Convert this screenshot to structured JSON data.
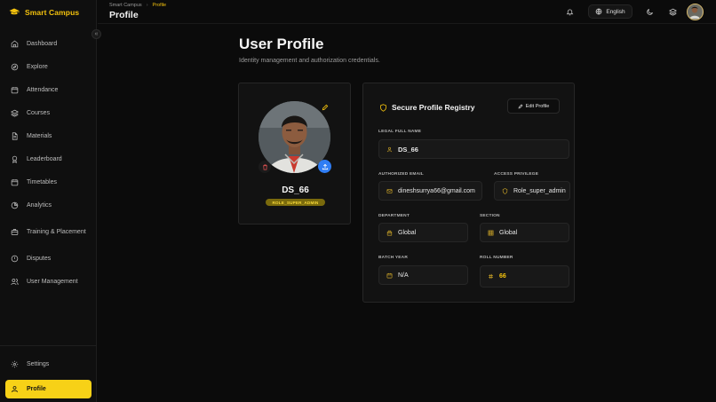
{
  "app": {
    "name": "Smart Campus"
  },
  "breadcrumb": {
    "root": "Smart Campus",
    "separator": "›",
    "current": "Profile"
  },
  "header": {
    "title": "Profile",
    "language": "English"
  },
  "sidebar": {
    "collapse_glyph": "«",
    "items": [
      {
        "label": "Dashboard",
        "icon": "home-icon"
      },
      {
        "label": "Explore",
        "icon": "compass-icon"
      },
      {
        "label": "Attendance",
        "icon": "calendar-icon"
      },
      {
        "label": "Courses",
        "icon": "layers-icon"
      },
      {
        "label": "Materials",
        "icon": "file-icon"
      },
      {
        "label": "Leaderboard",
        "icon": "award-icon"
      },
      {
        "label": "Timetables",
        "icon": "calendar-icon"
      },
      {
        "label": "Analytics",
        "icon": "pie-chart-icon"
      },
      {
        "label": "Training & Placement",
        "icon": "briefcase-icon"
      },
      {
        "label": "Disputes",
        "icon": "alert-icon"
      },
      {
        "label": "User Management",
        "icon": "users-icon"
      }
    ],
    "bottom": [
      {
        "label": "Settings",
        "icon": "gear-icon"
      },
      {
        "label": "Profile",
        "icon": "user-icon"
      }
    ]
  },
  "page": {
    "title": "User Profile",
    "subtitle": "Identity management and authorization credentials."
  },
  "profile_card": {
    "username": "DS_66",
    "role_badge": "ROLE_SUPER_ADMIN"
  },
  "registry": {
    "title": "Secure Profile Registry",
    "edit_button": "Edit Profile",
    "fields": {
      "legal_name": {
        "label": "LEGAL FULL NAME",
        "value": "DS_66"
      },
      "email": {
        "label": "AUTHORIZED EMAIL",
        "value": "dineshsurrya66@gmail.com"
      },
      "access": {
        "label": "ACCESS PRIVILEGE",
        "value": "Role_super_admin"
      },
      "department": {
        "label": "DEPARTMENT",
        "value": "Global"
      },
      "section": {
        "label": "SECTION",
        "value": "Global"
      },
      "batch_year": {
        "label": "BATCH YEAR",
        "value": "N/A"
      },
      "roll_number": {
        "label": "ROLL NUMBER",
        "value": "66"
      }
    }
  },
  "colors": {
    "accent": "#f4c20d",
    "active_nav": "#f7d117",
    "upload_button": "#2f7df4",
    "background": "#0b0b0b"
  }
}
